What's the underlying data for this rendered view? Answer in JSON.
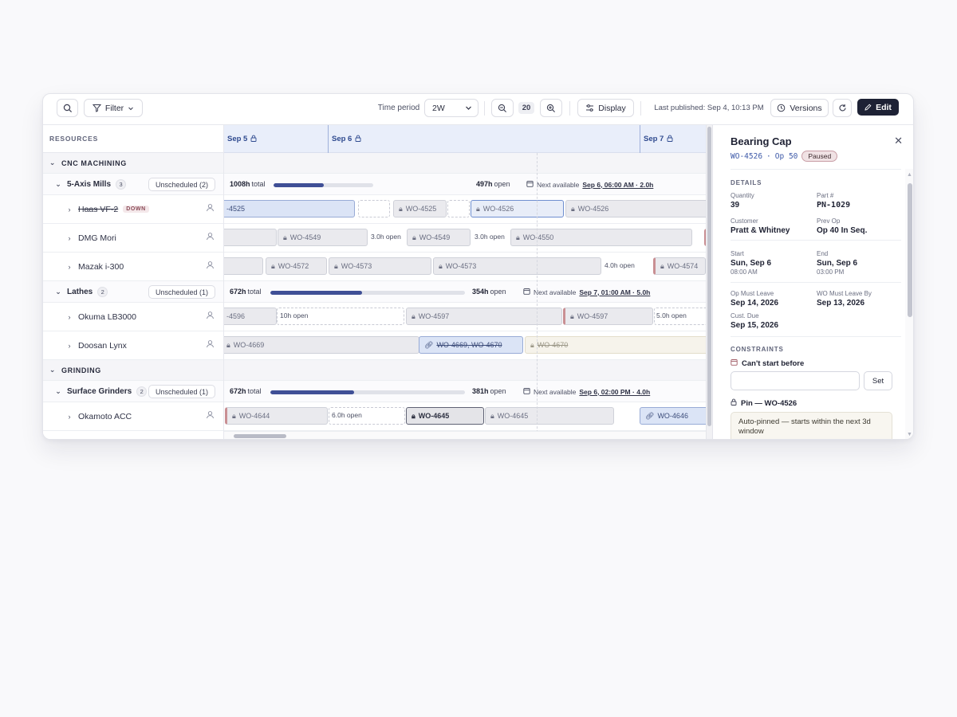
{
  "toolbar": {
    "filter_label": "Filter",
    "time_period_label": "Time period",
    "time_period_value": "2W",
    "zoom_value": "20",
    "display_label": "Display",
    "last_published": "Last published: Sep 4, 10:13 PM",
    "versions_label": "Versions",
    "edit_label": "Edit"
  },
  "resources_header": "RESOURCES",
  "days": [
    {
      "label": "Sep 5"
    },
    {
      "label": "Sep 6"
    },
    {
      "label": "Sep 7"
    }
  ],
  "groups": {
    "cnc": "CNC MACHINING",
    "grinding": "GRINDING"
  },
  "subgroups": {
    "mills": {
      "name": "5-Axis Mills",
      "count": "3",
      "unscheduled": "Unscheduled (2)",
      "total": "1008h",
      "total_label": "total",
      "open": "497h",
      "open_label": "open",
      "utilization_pct": 50,
      "next_label": "Next available",
      "next_value": "Sep 6, 06:00 AM · 2.0h"
    },
    "lathes": {
      "name": "Lathes",
      "count": "2",
      "unscheduled": "Unscheduled (1)",
      "total": "672h",
      "total_label": "total",
      "open": "354h",
      "open_label": "open",
      "utilization_pct": 47,
      "next_label": "Next available",
      "next_value": "Sep 7, 01:00 AM · 5.0h"
    },
    "grinders": {
      "name": "Surface Grinders",
      "count": "2",
      "unscheduled": "Unscheduled (1)",
      "total": "672h",
      "total_label": "total",
      "open": "381h",
      "open_label": "open",
      "utilization_pct": 43,
      "next_label": "Next available",
      "next_value": "Sep 6, 02:00 PM · 4.0h"
    }
  },
  "resources": {
    "haas": {
      "name": "Haas VF-2",
      "status": "DOWN"
    },
    "dmg": {
      "name": "DMG Mori"
    },
    "mazak": {
      "name": "Mazak i-300"
    },
    "okuma": {
      "name": "Okuma LB3000"
    },
    "doosan": {
      "name": "Doosan Lynx"
    },
    "okamoto": {
      "name": "Okamoto ACC"
    }
  },
  "bars": {
    "haas": [
      "-4525",
      "WO-4525",
      "WO-4526",
      "WO-4526"
    ],
    "dmg": [
      "WO-4549",
      "3.0h open",
      "WO-4549",
      "3.0h open",
      "WO-4550"
    ],
    "mazak": [
      "WO-4572",
      "WO-4573",
      "WO-4573",
      "4.0h open",
      "WO-4574"
    ],
    "okuma": [
      "-4596",
      "10h open",
      "WO-4597",
      "WO-4597",
      "5.0h open"
    ],
    "doosan": [
      "WO-4669",
      "WO-4669, WO-4670",
      "WO-4670"
    ],
    "okamoto": [
      "WO-4644",
      "6.0h open",
      "WO-4645",
      "WO-4645",
      "WO-4646"
    ]
  },
  "panel": {
    "title": "Bearing Cap",
    "wo": "WO-4526",
    "sep": "·",
    "op": "Op 50",
    "status": "Paused",
    "details_header": "DETAILS",
    "quantity_label": "Quantity",
    "quantity": "39",
    "part_label": "Part #",
    "part": "PN-1029",
    "customer_label": "Customer",
    "customer": "Pratt & Whitney",
    "prev_op_label": "Prev Op",
    "prev_op": "Op 40 In Seq.",
    "start_label": "Start",
    "start_date": "Sun, Sep 6",
    "start_time": "08:00 AM",
    "end_label": "End",
    "end_date": "Sun, Sep 6",
    "end_time": "03:00 PM",
    "op_must_leave_label": "Op Must Leave",
    "op_must_leave": "Sep 14, 2026",
    "wo_must_leave_label": "WO Must Leave By",
    "wo_must_leave": "Sep 13, 2026",
    "cust_due_label": "Cust. Due",
    "cust_due": "Sep 15, 2026",
    "constraints_header": "CONSTRAINTS",
    "cant_start_label": "Can't start before",
    "set_label": "Set",
    "pin_label": "Pin — WO-4526",
    "pin_note": "Auto-pinned — starts within the next 3d window"
  },
  "colors": {
    "accent": "#1e2235",
    "capacity_fill": "#3f4f96",
    "selected_bar": "#6f8fd0",
    "paused_badge": "#f0e2e4"
  }
}
